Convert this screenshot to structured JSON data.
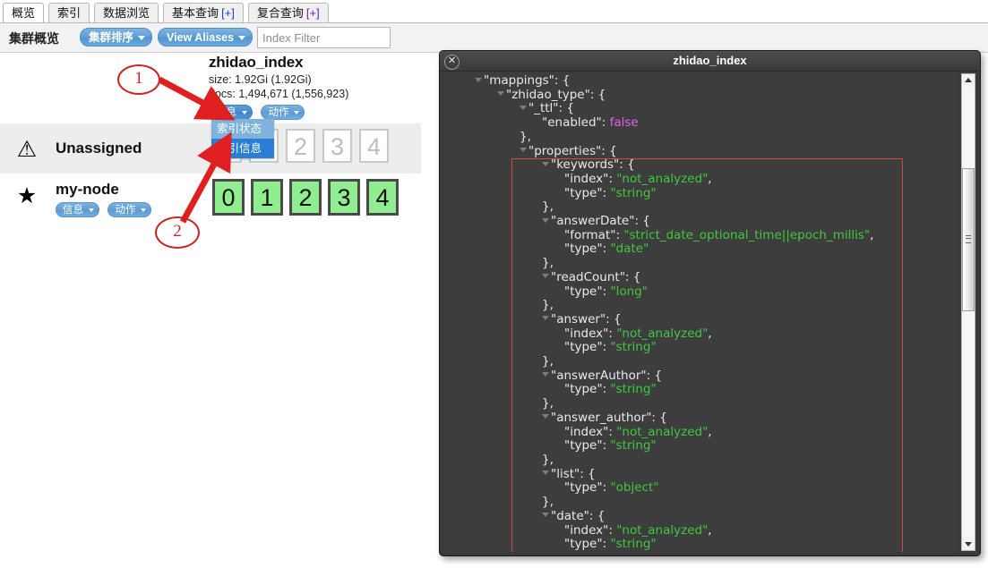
{
  "tabs": [
    {
      "label": "概览",
      "active": true,
      "plus": ""
    },
    {
      "label": "索引",
      "active": false,
      "plus": ""
    },
    {
      "label": "数据浏览",
      "active": false,
      "plus": ""
    },
    {
      "label": "基本查询",
      "active": false,
      "plus": "[+]"
    },
    {
      "label": "复合查询",
      "active": false,
      "plus": "[+]"
    }
  ],
  "toolbar": {
    "title": "集群概览",
    "sort_button": "集群排序",
    "aliases_button": "View Aliases",
    "filter_placeholder": "Index Filter",
    "filter_value": ""
  },
  "index": {
    "name": "zhidao_index",
    "size": "size: 1.92Gi (1.92Gi)",
    "docs": "docs: 1,494,671 (1,556,923)",
    "info_button": "信息",
    "action_button": "动作"
  },
  "dropdown": {
    "items": [
      {
        "label": "索引状态",
        "selected": false
      },
      {
        "label": "索引信息",
        "selected": true
      }
    ]
  },
  "nodes": [
    {
      "name": "Unassigned",
      "icon": "warning-icon",
      "shards": [
        "0",
        "1",
        "2",
        "3",
        "4"
      ],
      "state": "unassigned",
      "info_button": "",
      "action_button": ""
    },
    {
      "name": "my-node",
      "icon": "star-icon",
      "shards": [
        "0",
        "1",
        "2",
        "3",
        "4"
      ],
      "state": "assigned",
      "info_button": "信息",
      "action_button": "动作"
    }
  ],
  "annotations": [
    {
      "label": "1",
      "color": "#cc2222"
    },
    {
      "label": "2",
      "color": "#cc2222"
    }
  ],
  "modal": {
    "title": "zhidao_index",
    "close_label": "✕",
    "json_lines": [
      {
        "indent": 1,
        "tri": true,
        "text": "\"mappings\": {"
      },
      {
        "indent": 2,
        "tri": true,
        "text": "\"zhidao_type\": {"
      },
      {
        "indent": 3,
        "tri": true,
        "text": "\"_ttl\": {"
      },
      {
        "indent": 4,
        "tri": false,
        "key": "\"enabled\": ",
        "bool": "false"
      },
      {
        "indent": 3,
        "tri": false,
        "text": "},"
      },
      {
        "indent": 3,
        "tri": true,
        "text": "\"properties\": {"
      },
      {
        "indent": 4,
        "tri": true,
        "text": "\"keywords\": {"
      },
      {
        "indent": 5,
        "tri": false,
        "key": "\"index\": ",
        "str": "\"not_analyzed\"",
        "tail": ","
      },
      {
        "indent": 5,
        "tri": false,
        "key": "\"type\": ",
        "str": "\"string\""
      },
      {
        "indent": 4,
        "tri": false,
        "text": "},"
      },
      {
        "indent": 4,
        "tri": true,
        "text": "\"answerDate\": {"
      },
      {
        "indent": 5,
        "tri": false,
        "key": "\"format\": ",
        "str": "\"strict_date_optional_time||epoch_millis\"",
        "tail": ","
      },
      {
        "indent": 5,
        "tri": false,
        "key": "\"type\": ",
        "str": "\"date\""
      },
      {
        "indent": 4,
        "tri": false,
        "text": "},"
      },
      {
        "indent": 4,
        "tri": true,
        "text": "\"readCount\": {"
      },
      {
        "indent": 5,
        "tri": false,
        "key": "\"type\": ",
        "str": "\"long\""
      },
      {
        "indent": 4,
        "tri": false,
        "text": "},"
      },
      {
        "indent": 4,
        "tri": true,
        "text": "\"answer\": {"
      },
      {
        "indent": 5,
        "tri": false,
        "key": "\"index\": ",
        "str": "\"not_analyzed\"",
        "tail": ","
      },
      {
        "indent": 5,
        "tri": false,
        "key": "\"type\": ",
        "str": "\"string\""
      },
      {
        "indent": 4,
        "tri": false,
        "text": "},"
      },
      {
        "indent": 4,
        "tri": true,
        "text": "\"answerAuthor\": {"
      },
      {
        "indent": 5,
        "tri": false,
        "key": "\"type\": ",
        "str": "\"string\""
      },
      {
        "indent": 4,
        "tri": false,
        "text": "},"
      },
      {
        "indent": 4,
        "tri": true,
        "text": "\"answer_author\": {"
      },
      {
        "indent": 5,
        "tri": false,
        "key": "\"index\": ",
        "str": "\"not_analyzed\"",
        "tail": ","
      },
      {
        "indent": 5,
        "tri": false,
        "key": "\"type\": ",
        "str": "\"string\""
      },
      {
        "indent": 4,
        "tri": false,
        "text": "},"
      },
      {
        "indent": 4,
        "tri": true,
        "text": "\"list\": {"
      },
      {
        "indent": 5,
        "tri": false,
        "key": "\"type\": ",
        "str": "\"object\""
      },
      {
        "indent": 4,
        "tri": false,
        "text": "},"
      },
      {
        "indent": 4,
        "tri": true,
        "text": "\"date\": {"
      },
      {
        "indent": 5,
        "tri": false,
        "key": "\"index\": ",
        "str": "\"not_analyzed\"",
        "tail": ","
      },
      {
        "indent": 5,
        "tri": false,
        "key": "\"type\": ",
        "str": "\"string\""
      },
      {
        "indent": 4,
        "tri": false,
        "text": "}"
      }
    ]
  },
  "colors": {
    "accent_blue": "#5d9bd4",
    "annotation_red": "#cc2222",
    "shard_green": "#90ee90",
    "json_string_green": "#3ec93e",
    "json_bool_pink": "#e85de8",
    "modal_bg": "#3d3d3d"
  }
}
